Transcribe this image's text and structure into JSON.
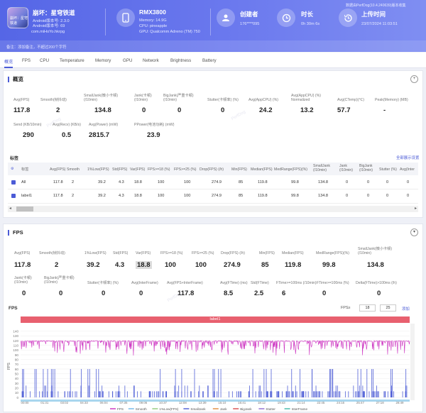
{
  "app": {
    "name": "崩坏：星穹铁道",
    "android_version_label": "Android版本号: 2.3.0",
    "android_build_label": "Android版本号: 69",
    "package": "com.miHoYo.hkrpg"
  },
  "device": {
    "model": "RMX3800",
    "memory": "Memory: 14.9G",
    "cpu": "CPU: pineapple",
    "gpu": "GPU: Qualcomm Adreno (TM) 750"
  },
  "creator": {
    "label": "创建者",
    "value": "176****095"
  },
  "duration": {
    "label": "时长",
    "value": "0h 30m 6s"
  },
  "upload": {
    "label": "上传时间",
    "value": "23/07/2024 11:03:51"
  },
  "header_link": "数据由PerfDog(10.4.240639)版本收集",
  "remark": "备注：添加备注，不超过200个字符",
  "tabs": [
    "概览",
    "FPS",
    "CPU",
    "Temperature",
    "Memory",
    "GPU",
    "Network",
    "Brightness",
    "Battery"
  ],
  "overview": {
    "title": "概览",
    "row1": [
      {
        "label": "Avg(FPS)",
        "value": "117.8"
      },
      {
        "label": "Smooth(帧抖动)",
        "value": "2"
      },
      {
        "label": "SmallJank(微小卡顿)\n(/10min)",
        "value": "134.8"
      },
      {
        "label": "Jank(卡顿)\n(/10min)",
        "value": "0"
      },
      {
        "label": "BigJank(严重卡顿)\n(/10min)",
        "value": "0"
      },
      {
        "label": "Stutter(卡顿率) (%)",
        "value": "0"
      },
      {
        "label": "Avg(AppCPU) (%)",
        "value": "24.2"
      },
      {
        "label": "Avg(AppCPU) (%)\nNormalized",
        "value": "13.2"
      },
      {
        "label": "Avg(CTemp)(℃)",
        "value": "57.7"
      },
      {
        "label": "Peak(Memory) (MB)",
        "value": "-"
      }
    ],
    "row2": [
      {
        "label": "Send (KB/10min)",
        "value": "290"
      },
      {
        "label": "Avg(Recv) (KB/s)",
        "value": "0.5"
      },
      {
        "label": "Avg(Power) (mW)",
        "value": "2815.7"
      },
      {
        "label": "PPower(电池功耗) (mW)",
        "value": "23.9"
      }
    ]
  },
  "table": {
    "title": "标签",
    "link": "全部展示设置",
    "headers": [
      "标签",
      "Avg(FPS)",
      "Smooth",
      "1%Low(FPS)",
      "Std(FPS)",
      "Var(FPS)",
      "FPS>=18 (%)",
      "FPS>=25 (%)",
      "Drop(FPS) (/h)",
      "Min(FPS)",
      "Median(FPS)",
      "MedRange(FPS)(%)",
      "SmallJank\n(/10min)",
      "Jank\n(/10min)",
      "BigJank\n(/10min)",
      "Stutter (%)",
      "Avg(Inter"
    ],
    "rows": [
      [
        "All",
        "117.8",
        "2",
        "39.2",
        "4.3",
        "18.8",
        "100",
        "100",
        "274.9",
        "85",
        "119.8",
        "99.8",
        "134.8",
        "0",
        "0",
        "0",
        "0"
      ],
      [
        "label1",
        "117.8",
        "2",
        "39.2",
        "4.3",
        "18.8",
        "100",
        "100",
        "274.9",
        "85",
        "119.8",
        "99.8",
        "134.8",
        "0",
        "0",
        "0",
        "0"
      ]
    ]
  },
  "fps": {
    "title": "FPS",
    "row1": [
      {
        "label": "Avg(FPS)",
        "value": "117.8"
      },
      {
        "label": "Smooth(帧抖动)",
        "value": "2"
      },
      {
        "label": "1%Low(FPS)",
        "value": "39.2"
      },
      {
        "label": "Std(FPS)",
        "value": "4.3"
      },
      {
        "label": "Var(FPS)",
        "value": "18.8"
      },
      {
        "label": "FPS>=18 (%)",
        "value": "100"
      },
      {
        "label": "FPS>=25 (%)",
        "value": "100"
      },
      {
        "label": "Drop(FPS) (/h)",
        "value": "274.9"
      },
      {
        "label": "Min(FPS)",
        "value": "85"
      },
      {
        "label": "Median(FPS)",
        "value": "119.8"
      },
      {
        "label": "MedRange(FPS)(%)",
        "value": "99.8"
      },
      {
        "label": "SmallJank(微小卡顿)\n(/10min)",
        "value": "134.8"
      }
    ],
    "row2": [
      {
        "label": "Jank(卡顿)\n(/10min)",
        "value": "0"
      },
      {
        "label": "BigJank(严重卡顿)\n(/10min)",
        "value": "0"
      },
      {
        "label": "Stutter(卡顿率) (%)",
        "value": "0"
      },
      {
        "label": "Avg(InterFrame)",
        "value": "0"
      },
      {
        "label": "Avg(FPS+InterFrame)",
        "value": "117.8"
      },
      {
        "label": "Avg(FTime) (ms)",
        "value": "8.5"
      },
      {
        "label": "Std(FTime)",
        "value": "2.5"
      },
      {
        "label": "FTime>=100ms (/10min)",
        "value": "6"
      },
      {
        "label": "FTime>=100ms (%)",
        "value": "0"
      },
      {
        "label": "Delta(FTime)>100ms (/h)",
        "value": "0"
      }
    ]
  },
  "chart_controls": {
    "label": "FPS≥",
    "v1": "18",
    "v2": "25",
    "link": "添加"
  },
  "chart_data": {
    "type": "line",
    "title": "FPS",
    "ylabel": "FPS",
    "ylim": [
      0,
      150
    ],
    "yticks": [
      "0",
      "10",
      "20",
      "30",
      "40",
      "50",
      "60",
      "70",
      "80",
      "90",
      "100",
      "110",
      "120",
      "130",
      "140"
    ],
    "xticks": [
      "00:00",
      "01:31",
      "03:02",
      "04:33",
      "06:04",
      "07:35",
      "09:06",
      "10:37",
      "12:08",
      "13:39",
      "15:10",
      "16:41",
      "18:12",
      "19:43",
      "21:14",
      "22:45",
      "24:16",
      "25:47",
      "27:18",
      "28:49"
    ],
    "label_band": "label1",
    "series": [
      {
        "name": "FPS",
        "color": "#cc2fc0",
        "baseline": 120
      },
      {
        "name": "SmallJank",
        "color": "#4b5bd6"
      }
    ],
    "legend": [
      "FPS",
      "Smooth",
      "1%Low(FPS)",
      "SmallJank",
      "Jank",
      "BigJank",
      "Stutter",
      "InterFrame"
    ],
    "legend_colors": [
      "#cc2fc0",
      "#6db7e8",
      "#8fc97a",
      "#4b5bd6",
      "#e08a3c",
      "#d94b4b",
      "#8e6ad1",
      "#3fb8a8"
    ]
  }
}
